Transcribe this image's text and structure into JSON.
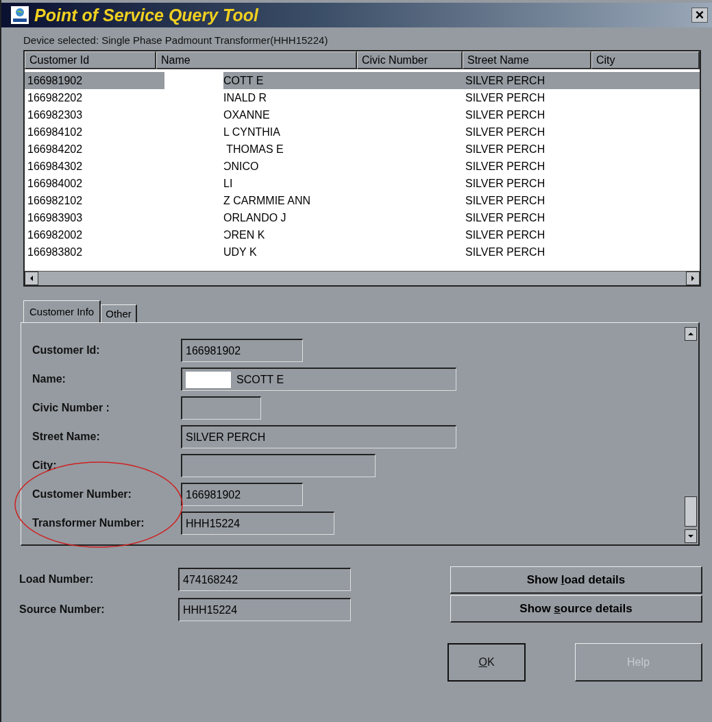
{
  "window": {
    "title": "Point of Service Query Tool",
    "close": "×"
  },
  "device_label": "Device selected: Single Phase Padmount Transformer(HHH15224)",
  "table": {
    "columns": [
      "Customer Id",
      "Name",
      "Civic Number",
      "Street Name",
      "City"
    ],
    "rows": [
      {
        "customer_id": "166981902",
        "name": "COTT E",
        "street_name": "SILVER PERCH",
        "selected": true
      },
      {
        "customer_id": "166982202",
        "name": "INALD R",
        "street_name": "SILVER PERCH",
        "selected": false
      },
      {
        "customer_id": "166982303",
        "name": "OXANNE",
        "street_name": "SILVER PERCH",
        "selected": false
      },
      {
        "customer_id": "166984102",
        "name": "L CYNTHIA",
        "street_name": "SILVER PERCH",
        "selected": false
      },
      {
        "customer_id": "166984202",
        "name": " THOMAS E",
        "street_name": "SILVER PERCH",
        "selected": false
      },
      {
        "customer_id": "166984302",
        "name": "ƆNICO",
        "street_name": "SILVER PERCH",
        "selected": false
      },
      {
        "customer_id": "166984002",
        "name": "LI",
        "street_name": "SILVER PERCH",
        "selected": false
      },
      {
        "customer_id": "166982102",
        "name": "Z CARMMIE ANN",
        "street_name": "SILVER PERCH",
        "selected": false
      },
      {
        "customer_id": "166983903",
        "name": "ORLANDO J",
        "street_name": "SILVER PERCH",
        "selected": false
      },
      {
        "customer_id": "166982002",
        "name": "ƆREN K",
        "street_name": "SILVER PERCH",
        "selected": false
      },
      {
        "customer_id": "166983802",
        "name": "UDY K",
        "street_name": "SILVER PERCH",
        "selected": false
      }
    ]
  },
  "tabs": [
    {
      "label": "Customer Info",
      "selected": true
    },
    {
      "label": "Other",
      "selected": false
    }
  ],
  "fields": [
    {
      "label": "Customer Id:",
      "value": "166981902",
      "kind": "short"
    },
    {
      "label": "Name:",
      "value": "SCOTT E",
      "kind": "redacted"
    },
    {
      "label": "Civic Number :",
      "kind": "tiny"
    },
    {
      "label": "Street Name:",
      "value": "SILVER PERCH",
      "kind": "long"
    },
    {
      "label": "City:",
      "kind": "medium"
    },
    {
      "label": "Customer Number:",
      "value": "166981902",
      "kind": "short"
    },
    {
      "label": "Transformer Number:",
      "value": "HHH15224",
      "kind": "wide"
    }
  ],
  "bottom_fields": [
    {
      "label": "Load Number:",
      "value": "474168242"
    },
    {
      "label": "Source Number:",
      "value": "HHH15224"
    }
  ],
  "detail_buttons": [
    {
      "before": "Show ",
      "key": "l",
      "after": "oad details"
    },
    {
      "before": "Show ",
      "key": "s",
      "after": "ource details"
    }
  ],
  "dialog_buttons": [
    {
      "key": "O",
      "after": "K",
      "disabled": false
    },
    {
      "before": "Help",
      "disabled": true
    }
  ]
}
